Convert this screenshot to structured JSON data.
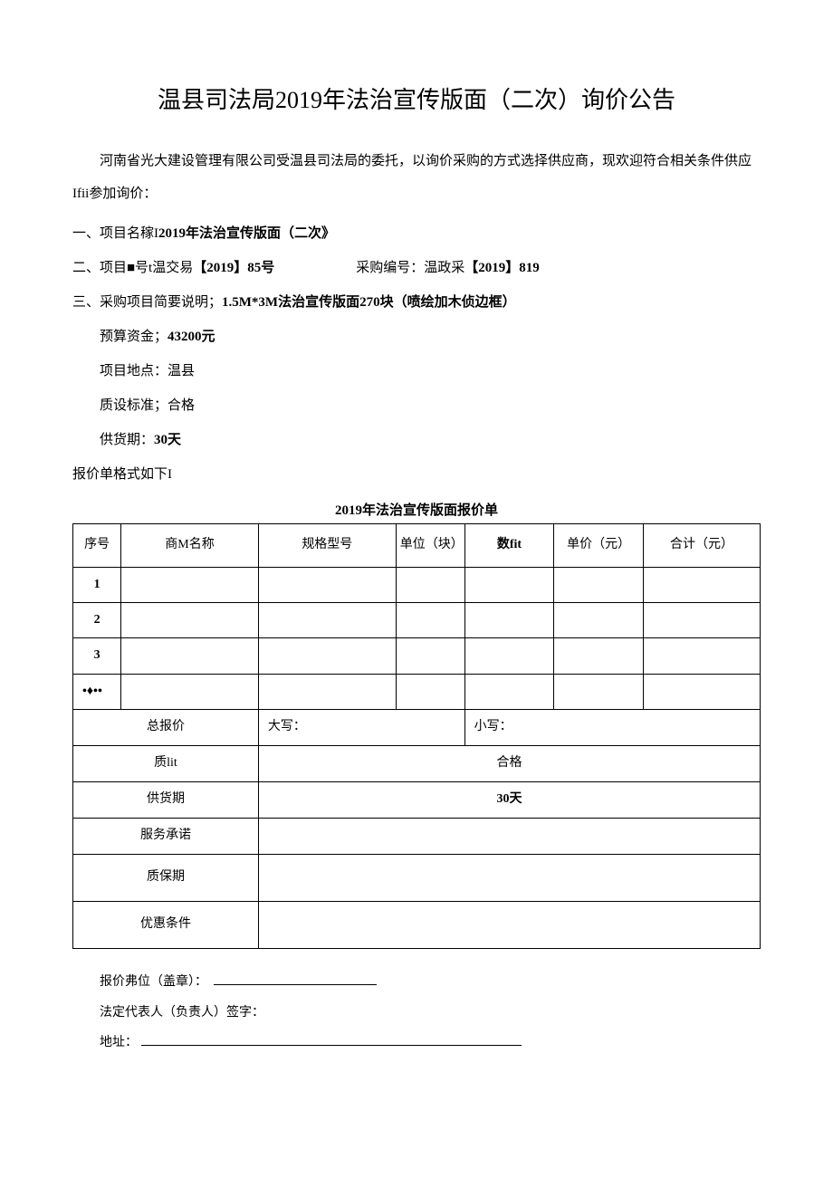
{
  "title": "温县司法局2019年法治宣传版面（二次）询价公告",
  "intro": "河南省光大建设管理有限公司受温县司法局的委托，以询价采购的方式选择供应商，现欢迎符合相关条件供应Ifii参加询价：",
  "items": {
    "item1_label": "一、项目名稼I",
    "item1_value": "2019年法治宣传版面（二次》",
    "item2_label": "二、项目■号t温交易",
    "item2_value": "【2019】85号",
    "item2_label2": "采购编号：温政采",
    "item2_value2": "【2019】819",
    "item3_label": "三、采购项目简要说明；",
    "item3_value": "1.5M*3M法治宣传版面270块（喷绘加木侦边框）",
    "budget_label": "预算资金；",
    "budget_value": "43200元",
    "location_label": "项目地点：",
    "location_value": "温县",
    "quality_label": "质设标准；",
    "quality_value": "合格",
    "delivery_label": "供货期：",
    "delivery_value": "30天",
    "form_label": "报价单格式如下I"
  },
  "table": {
    "caption": "2019年法治宣传版面报价单",
    "headers": {
      "seq": "序号",
      "name": "商M名称",
      "spec": "规格型号",
      "unit": "单位（块）",
      "qty": "数fit",
      "price": "单价（元）",
      "total": "合计（元）"
    },
    "rows": {
      "r1": "1",
      "r2": "2",
      "r3": "3",
      "r4": "•♦••"
    },
    "footer": {
      "total_label": "总报价",
      "daxie": "大写：",
      "xiaoxie": "小写：",
      "quality_label": "质lit",
      "quality_value": "合格",
      "delivery_label": "供货期",
      "delivery_value": "30天",
      "service_label": "服务承诺",
      "warranty_label": "质保期",
      "discount_label": "优惠条件"
    }
  },
  "signature": {
    "unit": "报价弗位（盖章）：",
    "rep": "法定代表人（负责人）签字：",
    "addr": "地址："
  }
}
